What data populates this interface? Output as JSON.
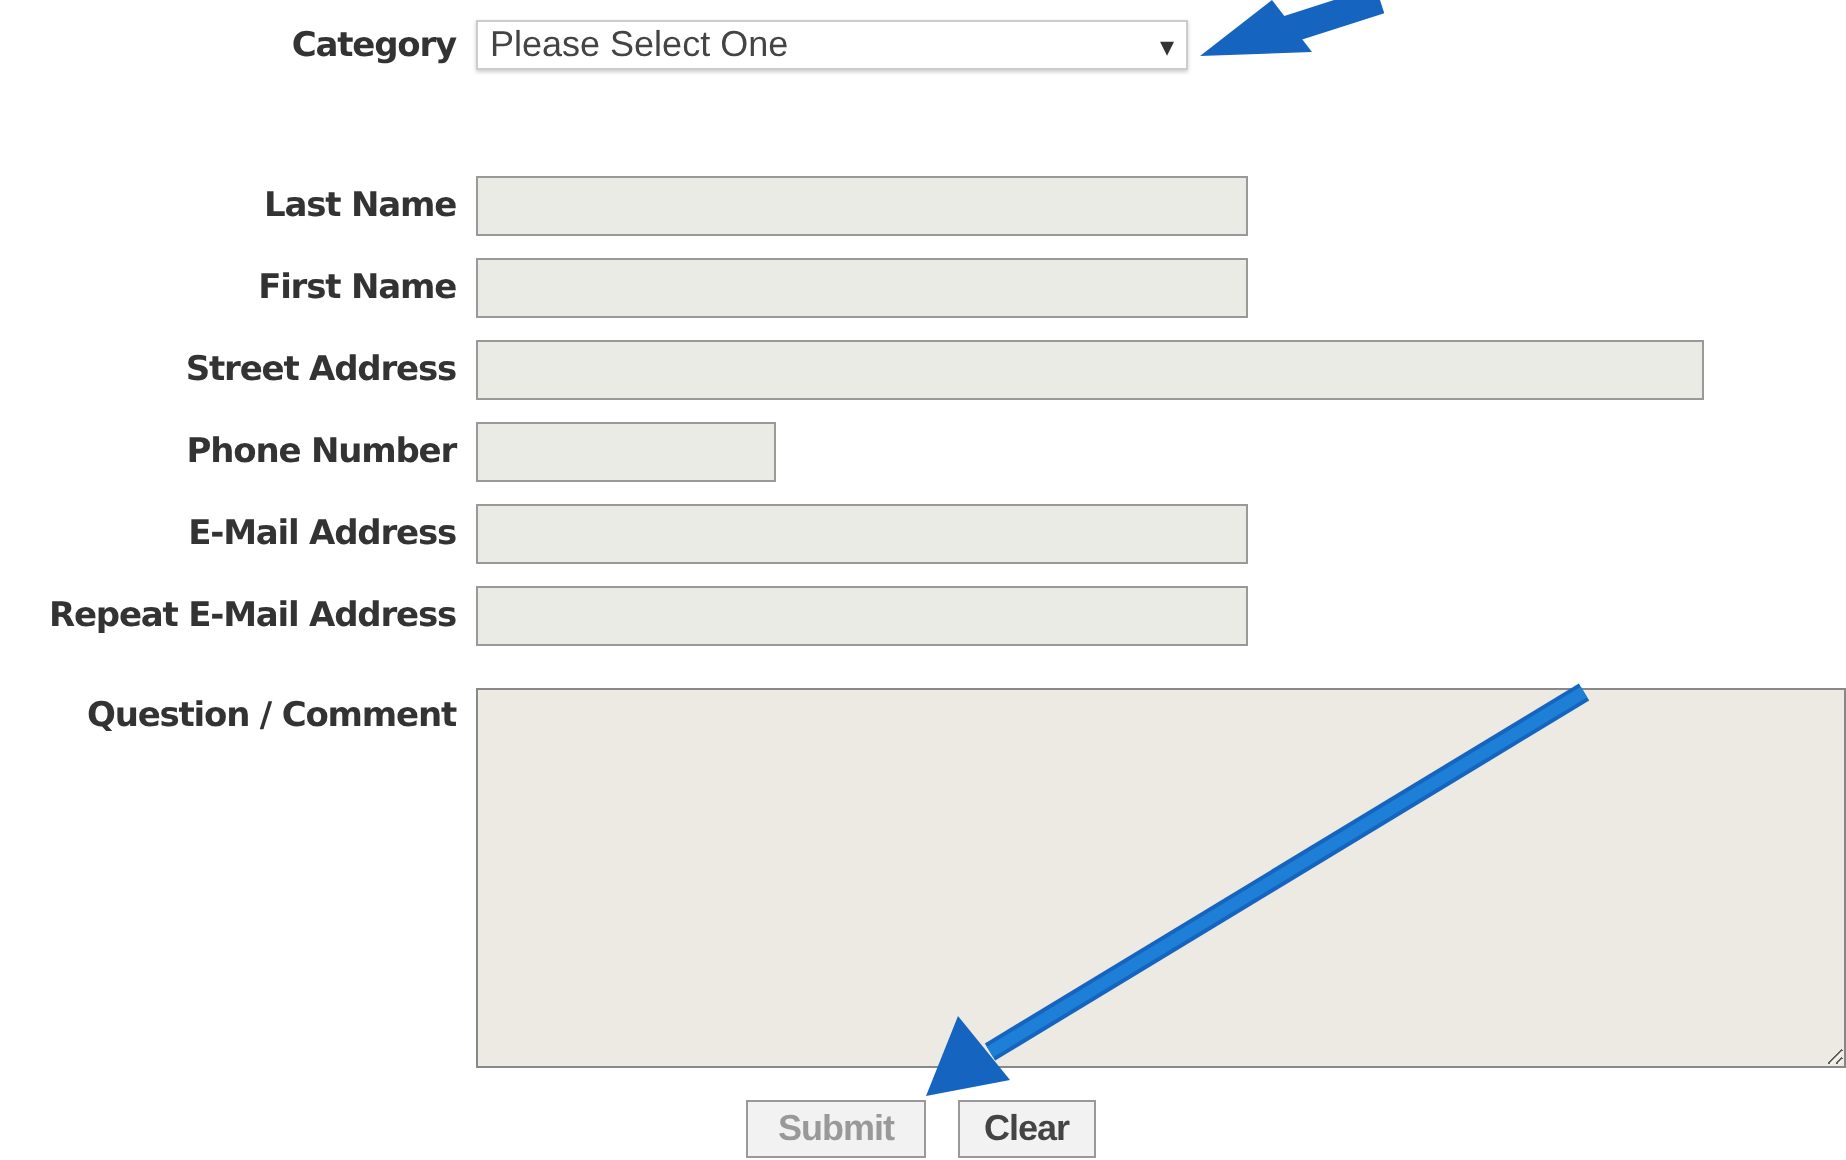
{
  "category": {
    "label": "Category",
    "value": "Please Select One",
    "caret": "▾"
  },
  "fields": [
    {
      "label": "Last Name",
      "kind": "medium"
    },
    {
      "label": "First Name",
      "kind": "medium"
    },
    {
      "label": "Street Address",
      "kind": "long"
    },
    {
      "label": "Phone Number",
      "kind": "short"
    },
    {
      "label": "E-Mail Address",
      "kind": "medium"
    },
    {
      "label": "Repeat E-Mail Address",
      "kind": "medium"
    }
  ],
  "comment": {
    "label": "Question / Comment"
  },
  "buttons": [
    {
      "label": "Submit",
      "disabled": true
    },
    {
      "label": "Clear",
      "disabled": false
    }
  ]
}
